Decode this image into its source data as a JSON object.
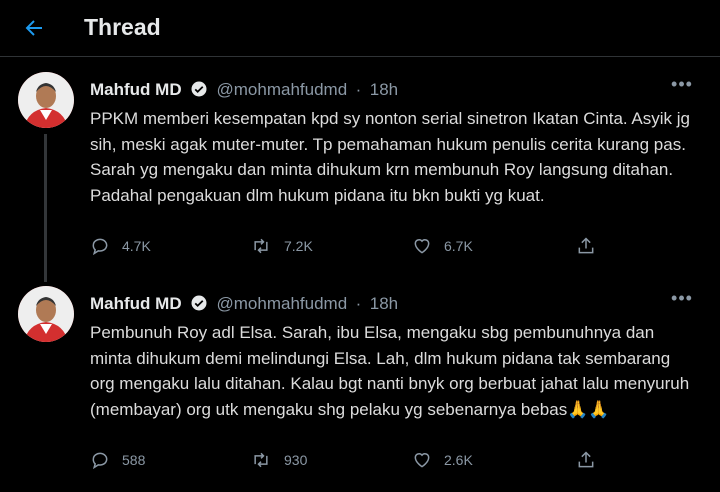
{
  "header": {
    "title": "Thread",
    "back_icon": "arrow-left-icon",
    "accent": "#1d9bf0"
  },
  "tweets": [
    {
      "name": "Mahfud MD",
      "handle": "@mohmahfudmd",
      "time": "18h",
      "text": "PPKM memberi kesempatan kpd sy nonton serial sinetron Ikatan Cinta. Asyik jg sih, meski agak muter-muter. Tp pemahaman hukum penulis cerita kurang pas. Sarah yg mengaku dan minta dihukum krn membunuh Roy langsung ditahan. Padahal pengakuan dlm hukum pidana itu bkn bukti yg kuat.",
      "replies": "4.7K",
      "retweets": "7.2K",
      "likes": "6.7K"
    },
    {
      "name": "Mahfud MD",
      "handle": "@mohmahfudmd",
      "time": "18h",
      "text": "Pembunuh Roy adl Elsa. Sarah, ibu Elsa, mengaku sbg pembunuhnya dan minta dihukum demi melindungi Elsa. Lah, dlm hukum pidana tak sembarang org mengaku lalu ditahan. Kalau bgt nanti bnyk org berbuat jahat lalu menyuruh (membayar) org utk mengaku shg pelaku yg sebenarnya bebas🙏🙏",
      "replies": "588",
      "retweets": "930",
      "likes": "2.6K"
    }
  ]
}
